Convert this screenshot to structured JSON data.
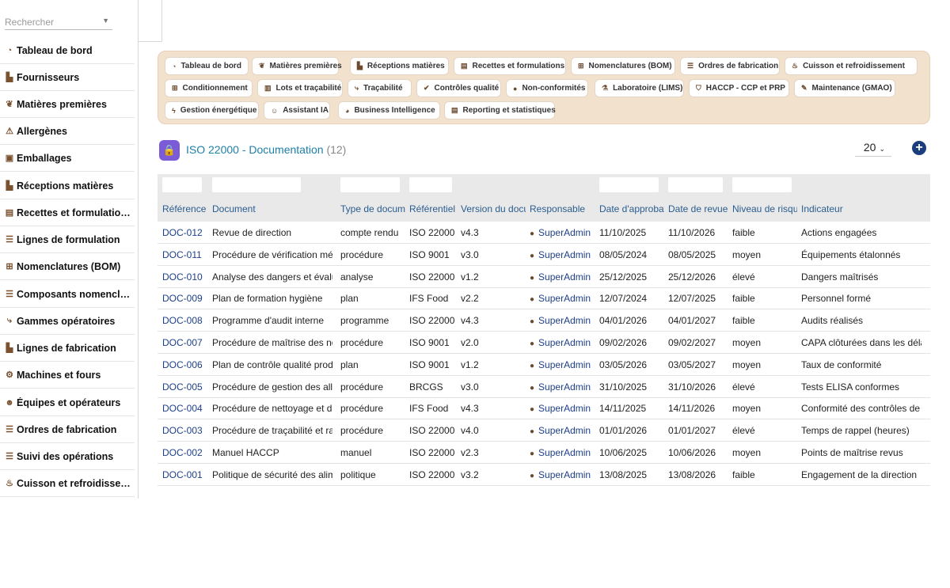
{
  "search": {
    "placeholder": "Rechercher"
  },
  "sidebar": {
    "items": [
      {
        "icon": "dashboard-icon",
        "glyph": "◔",
        "label": "Tableau de bord"
      },
      {
        "icon": "truck-icon",
        "glyph": "▙",
        "label": "Fournisseurs"
      },
      {
        "icon": "wheat-icon",
        "glyph": "❦",
        "label": "Matières premières"
      },
      {
        "icon": "warning-icon",
        "glyph": "⚠",
        "label": "Allergènes"
      },
      {
        "icon": "box-icon",
        "glyph": "▣",
        "label": "Emballages"
      },
      {
        "icon": "delivery-icon",
        "glyph": "▙",
        "label": "Réceptions matières"
      },
      {
        "icon": "book-icon",
        "glyph": "▤",
        "label": "Recettes et formulations"
      },
      {
        "icon": "list-icon",
        "glyph": "☰",
        "label": "Lignes de formulation"
      },
      {
        "icon": "hierarchy-icon",
        "glyph": "⊞",
        "label": "Nomenclatures (BOM)"
      },
      {
        "icon": "list-icon",
        "glyph": "☰",
        "label": "Composants nomenclature"
      },
      {
        "icon": "route-icon",
        "glyph": "⤷",
        "label": "Gammes opératoires"
      },
      {
        "icon": "factory-icon",
        "glyph": "▙",
        "label": "Lignes de fabrication"
      },
      {
        "icon": "gears-icon",
        "glyph": "⚙",
        "label": "Machines et fours"
      },
      {
        "icon": "users-icon",
        "glyph": "☻",
        "label": "Équipes et opérateurs"
      },
      {
        "icon": "list-icon",
        "glyph": "☰",
        "label": "Ordres de fabrication"
      },
      {
        "icon": "list-icon",
        "glyph": "☰",
        "label": "Suivi des opérations"
      },
      {
        "icon": "flame-icon",
        "glyph": "♨",
        "label": "Cuisson et refroidissement"
      }
    ]
  },
  "nav": {
    "chips": [
      {
        "icon": "dashboard-icon",
        "glyph": "◔",
        "label": "Tableau de bord"
      },
      {
        "icon": "wheat-icon",
        "glyph": "❦",
        "label": "Matières premières"
      },
      {
        "icon": "delivery-icon",
        "glyph": "▙",
        "label": "Réceptions matières"
      },
      {
        "icon": "book-icon",
        "glyph": "▤",
        "label": "Recettes et formulations"
      },
      {
        "icon": "hierarchy-icon",
        "glyph": "⊞",
        "label": "Nomenclatures (BOM)"
      },
      {
        "icon": "list-icon",
        "glyph": "☰",
        "label": "Ordres de fabrication"
      },
      {
        "icon": "flame-icon",
        "glyph": "♨",
        "label": "Cuisson et refroidissement"
      },
      {
        "icon": "package-icon",
        "glyph": "⊞",
        "label": "Conditionnement"
      },
      {
        "icon": "barcode-icon",
        "glyph": "▥",
        "label": "Lots et traçabilité"
      },
      {
        "icon": "route-icon",
        "glyph": "⤷",
        "label": "Traçabilité"
      },
      {
        "icon": "check-circle-icon",
        "glyph": "✔",
        "label": "Contrôles qualité"
      },
      {
        "icon": "alert-circle-icon",
        "glyph": "●",
        "label": "Non-conformités"
      },
      {
        "icon": "flask-icon",
        "glyph": "⚗",
        "label": "Laboratoire (LIMS)"
      },
      {
        "icon": "shield-icon",
        "glyph": "⛉",
        "label": "HACCP - CCP et PRP"
      },
      {
        "icon": "wrench-icon",
        "glyph": "✎",
        "label": "Maintenance (GMAO)"
      },
      {
        "icon": "bolt-icon",
        "glyph": "ϟ",
        "label": "Gestion énergétique"
      },
      {
        "icon": "robot-icon",
        "glyph": "☺",
        "label": "Assistant IA"
      },
      {
        "icon": "chart-pie-icon",
        "glyph": "◕",
        "label": "Business Intelligence"
      },
      {
        "icon": "report-icon",
        "glyph": "▤",
        "label": "Reporting et statistiques"
      }
    ]
  },
  "header": {
    "title": "ISO 22000 - Documentation",
    "count": "(12)",
    "page_size": "20"
  },
  "table": {
    "columns": [
      "Référence",
      "Document",
      "Type de document",
      "Référentiel",
      "Version du document",
      "Responsable",
      "Date d'approbation",
      "Date de revue",
      "Niveau de risque",
      "Indicateur"
    ],
    "rows": [
      [
        "DOC-012",
        "Revue de direction",
        "compte rendu",
        "ISO 22000",
        "v4.3",
        "SuperAdmin",
        "11/10/2025",
        "11/10/2026",
        "faible",
        "Actions engagées"
      ],
      [
        "DOC-011",
        "Procédure de vérification métrologique",
        "procédure",
        "ISO 9001",
        "v3.0",
        "SuperAdmin",
        "08/05/2024",
        "08/05/2025",
        "moyen",
        "Équipements étalonnés"
      ],
      [
        "DOC-010",
        "Analyse des dangers et évaluation",
        "analyse",
        "ISO 22000",
        "v1.2",
        "SuperAdmin",
        "25/12/2025",
        "25/12/2026",
        "élevé",
        "Dangers maîtrisés"
      ],
      [
        "DOC-009",
        "Plan de formation hygiène",
        "plan",
        "IFS Food",
        "v2.2",
        "SuperAdmin",
        "12/07/2024",
        "12/07/2025",
        "faible",
        "Personnel formé"
      ],
      [
        "DOC-008",
        "Programme d'audit interne",
        "programme",
        "ISO 22000",
        "v4.3",
        "SuperAdmin",
        "04/01/2026",
        "04/01/2027",
        "faible",
        "Audits réalisés"
      ],
      [
        "DOC-007",
        "Procédure de maîtrise des non-conformités",
        "procédure",
        "ISO 9001",
        "v2.0",
        "SuperAdmin",
        "09/02/2026",
        "09/02/2027",
        "moyen",
        "CAPA clôturées dans les délais"
      ],
      [
        "DOC-006",
        "Plan de contrôle qualité produit",
        "plan",
        "ISO 9001",
        "v1.2",
        "SuperAdmin",
        "03/05/2026",
        "03/05/2027",
        "moyen",
        "Taux de conformité"
      ],
      [
        "DOC-005",
        "Procédure de gestion des allergènes",
        "procédure",
        "BRCGS",
        "v3.0",
        "SuperAdmin",
        "31/10/2025",
        "31/10/2026",
        "élevé",
        "Tests ELISA conformes"
      ],
      [
        "DOC-004",
        "Procédure de nettoyage et désinfection",
        "procédure",
        "IFS Food",
        "v4.3",
        "SuperAdmin",
        "14/11/2025",
        "14/11/2026",
        "moyen",
        "Conformité des contrôles de surface"
      ],
      [
        "DOC-003",
        "Procédure de traçabilité et rappel",
        "procédure",
        "ISO 22000",
        "v4.0",
        "SuperAdmin",
        "01/01/2026",
        "01/01/2027",
        "élevé",
        "Temps de rappel (heures)"
      ],
      [
        "DOC-002",
        "Manuel HACCP",
        "manuel",
        "ISO 22000",
        "v2.3",
        "SuperAdmin",
        "10/06/2025",
        "10/06/2026",
        "moyen",
        "Points de maîtrise revus"
      ],
      [
        "DOC-001",
        "Politique de sécurité des aliments",
        "politique",
        "ISO 22000",
        "v3.2",
        "SuperAdmin",
        "13/08/2025",
        "13/08/2026",
        "faible",
        "Engagement de la direction"
      ]
    ]
  }
}
